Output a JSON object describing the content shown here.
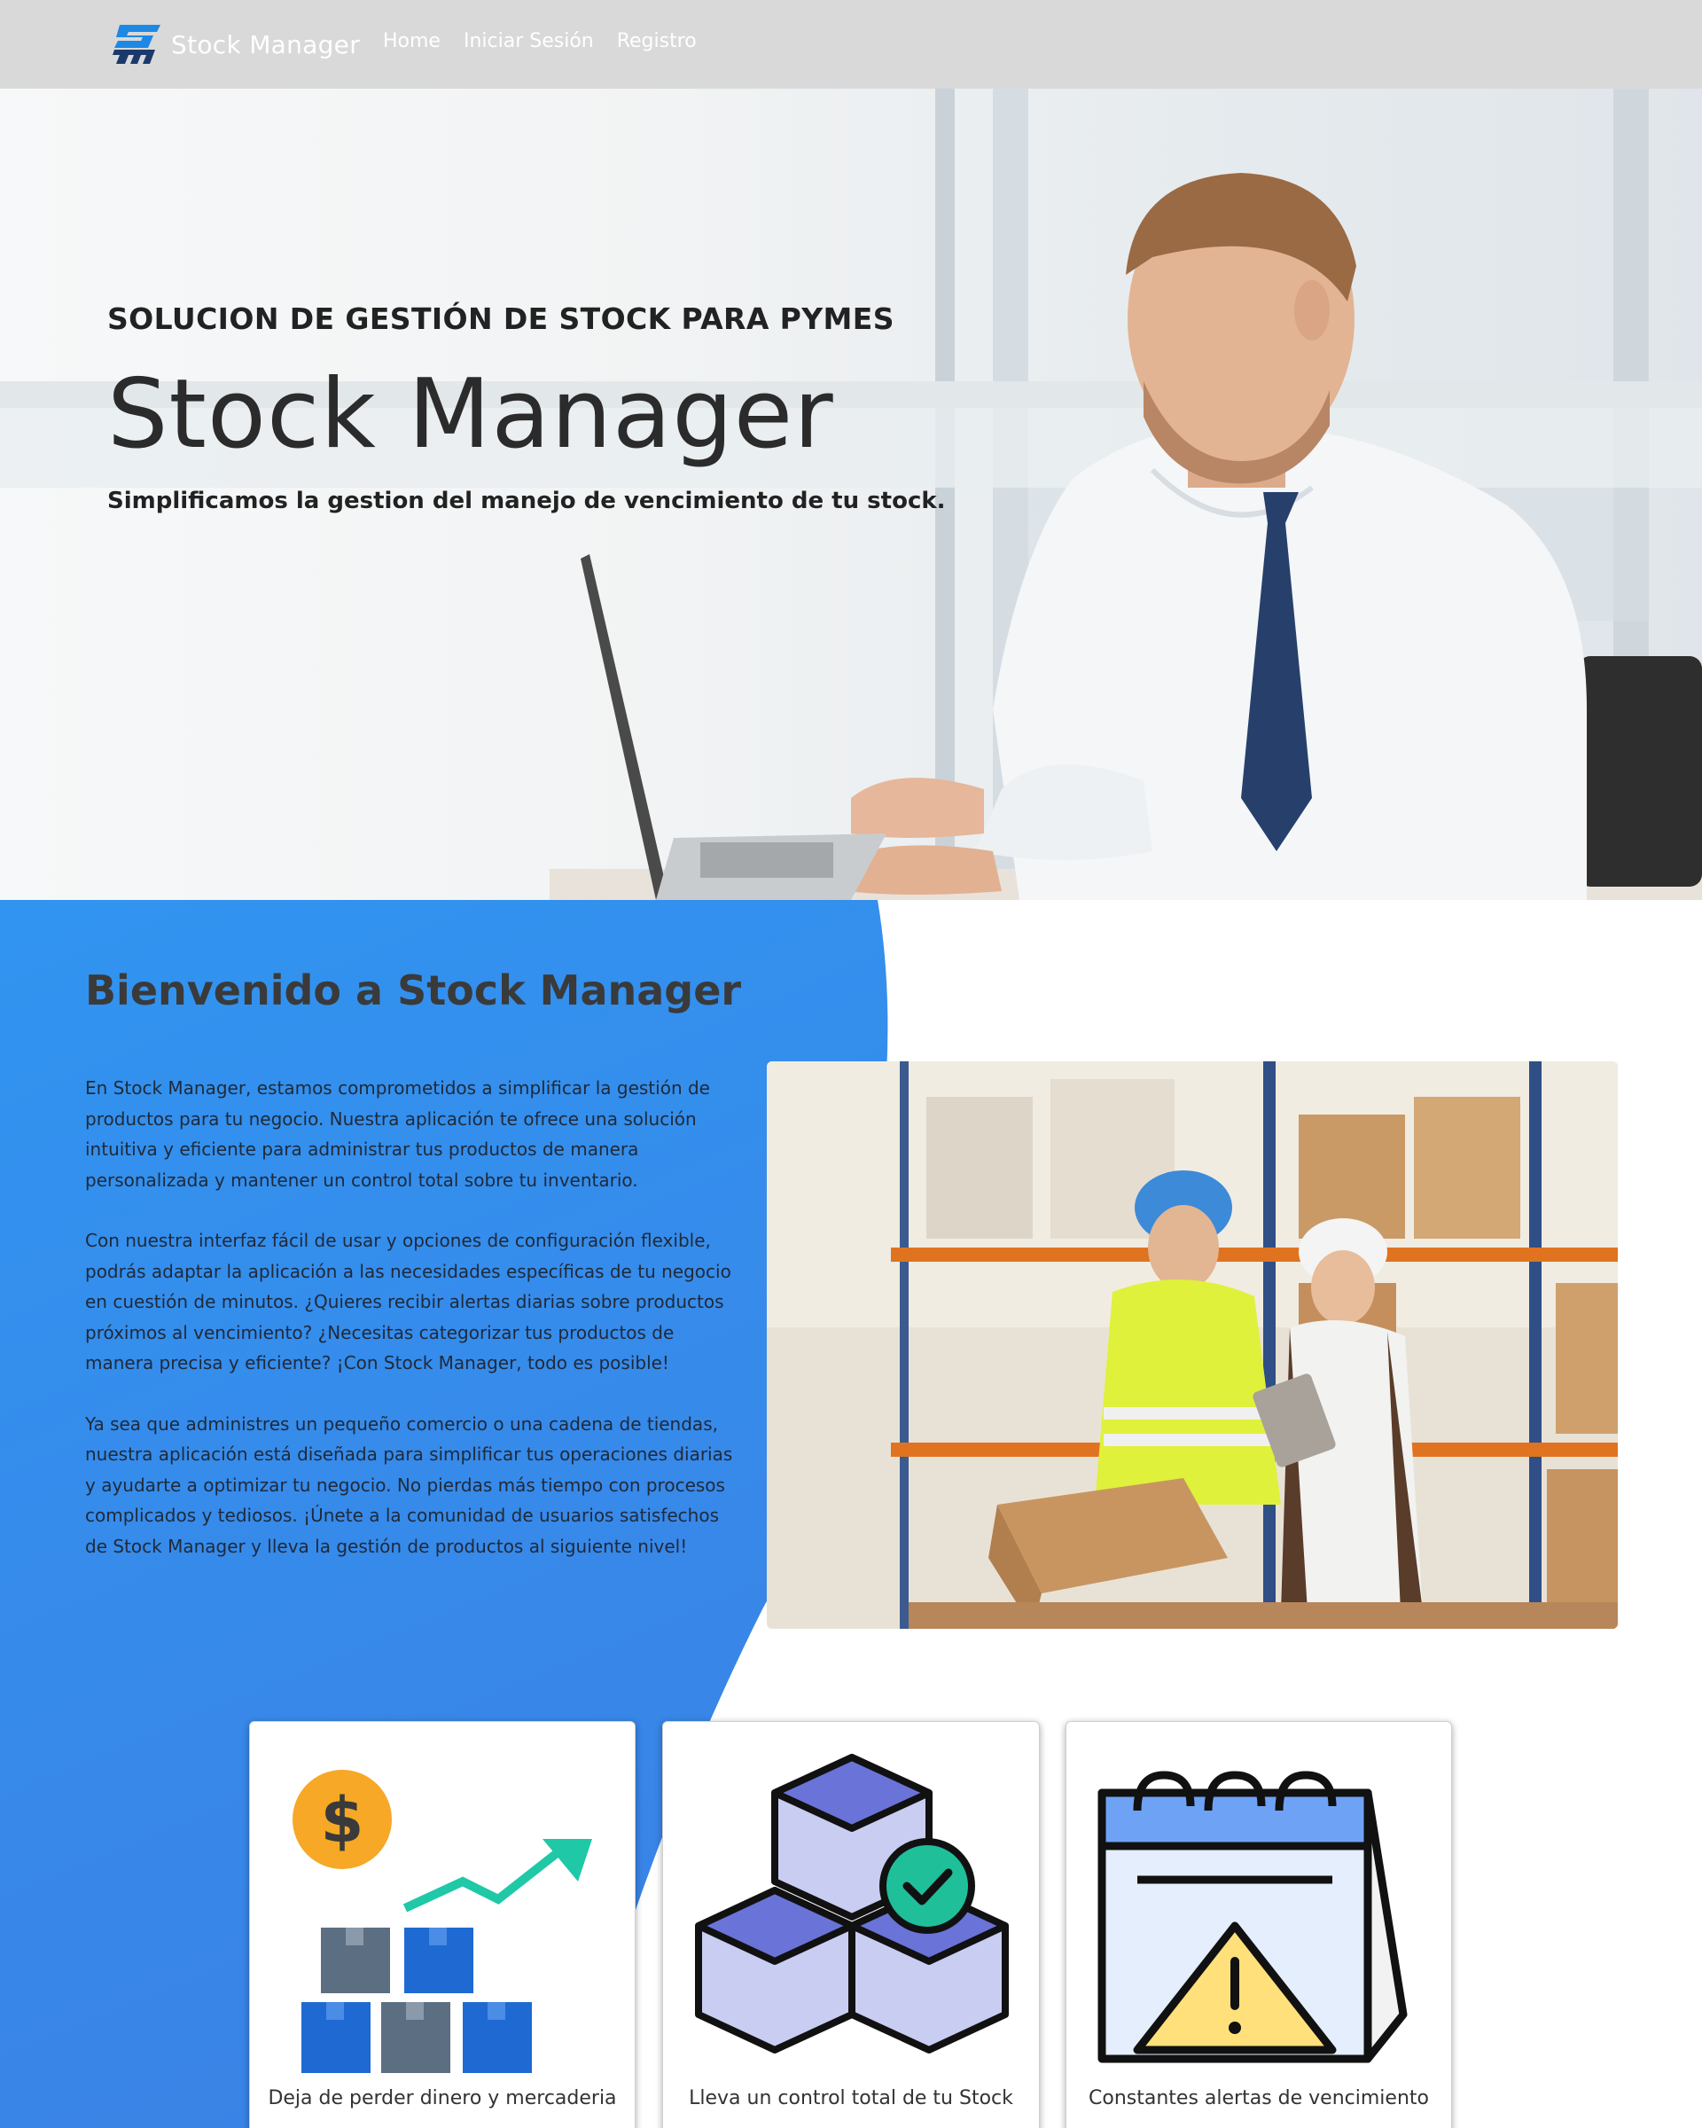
{
  "navbar": {
    "brand": "Stock Manager",
    "links": [
      "Home",
      "Iniciar Sesión",
      "Registro"
    ]
  },
  "hero": {
    "kicker": "SOLUCION DE GESTIÓN DE STOCK PARA PYMES",
    "title": "Stock Manager",
    "subtitle": "Simplificamos la gestion del manejo de vencimiento de tu stock."
  },
  "welcome": {
    "title": "Bienvenido a Stock Manager",
    "paragraphs": [
      "En Stock Manager, estamos comprometidos a simplificar la gestión de productos para tu negocio. Nuestra aplicación te ofrece una solución intuitiva y eficiente para administrar tus productos de manera personalizada y mantener un control total sobre tu inventario.",
      "Con nuestra interfaz fácil de usar y opciones de configuración flexible, podrás adaptar la aplicación a las necesidades específicas de tu negocio en cuestión de minutos. ¿Quieres recibir alertas diarias sobre productos próximos al vencimiento? ¿Necesitas categorizar tus productos de manera precisa y eficiente? ¡Con Stock Manager, todo es posible!",
      "Ya sea que administres un pequeño comercio o una cadena de tiendas, nuestra aplicación está diseñada para simplificar tus operaciones diarias y ayudarte a optimizar tu negocio. No pierdas más tiempo con procesos complicados y tediosos. ¡Únete a la comunidad de usuarios satisfechos de Stock Manager y lleva la gestión de productos al siguiente nivel!"
    ]
  },
  "cards": [
    {
      "label": "Deja de perder dinero y mercaderia",
      "icon": "money-growth-icon"
    },
    {
      "label": "Lleva un control total de tu Stock",
      "icon": "boxes-check-icon"
    },
    {
      "label": "Constantes alertas de vencimiento",
      "icon": "calendar-alert-icon"
    }
  ],
  "colors": {
    "navbar_bg": "#d9d9d9",
    "accent_blue": "#2f8cf0",
    "brand_blue": "#1565c0"
  }
}
